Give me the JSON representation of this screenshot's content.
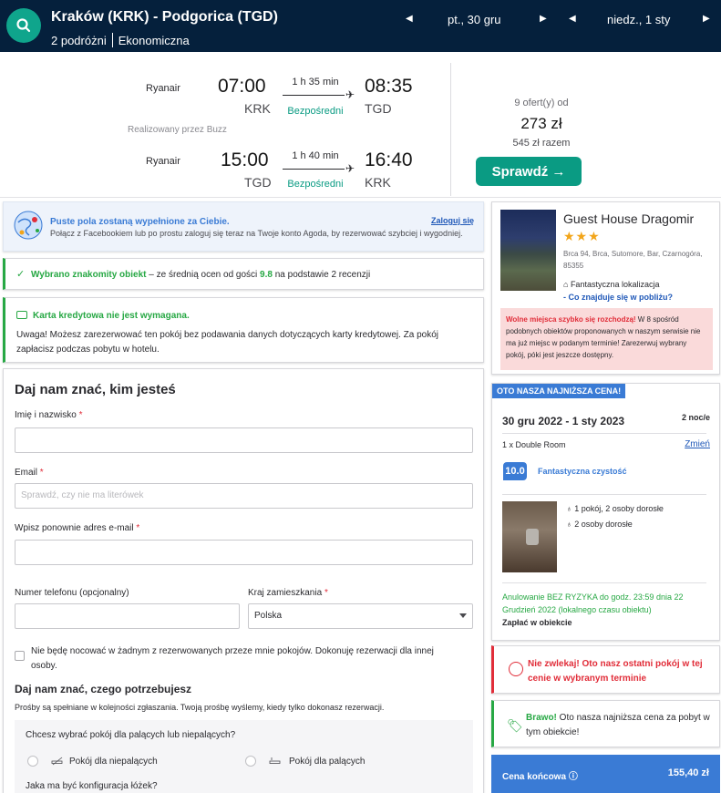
{
  "header": {
    "route": "Kraków (KRK) - Podgorica (TGD)",
    "travelers": "2 podróżni",
    "cabin": "Ekonomiczna",
    "depart_date": "pt., 30 gru",
    "return_date": "niedz., 1 sty",
    "prev_glyph": "◀",
    "next_glyph": "▶"
  },
  "flights": {
    "outbound": {
      "airline": "Ryanair",
      "dep_time": "07:00",
      "dep_airport": "KRK",
      "duration": "1 h 35 min",
      "stops": "Bezpośredni",
      "arr_time": "08:35",
      "arr_airport": "TGD"
    },
    "operated_by": "Realizowany przez Buzz",
    "return": {
      "airline": "Ryanair",
      "dep_time": "15:00",
      "dep_airport": "TGD",
      "duration": "1 h 40 min",
      "stops": "Bezpośredni",
      "arr_time": "16:40",
      "arr_airport": "KRK"
    },
    "offers": "9 ofert(y) od",
    "price": "273 zł",
    "total": "545 zł razem",
    "check_label": "Sprawdź →"
  },
  "facebook": {
    "title": "Puste pola zostaną wypełnione za Ciebie.",
    "text": "Połącz z Facebookiem lub po prostu zaloguj się teraz na Twoje konto Agoda, by rezerwować szybciej i wygodniej.",
    "login": "Zaloguj się"
  },
  "great_property": {
    "bold": "Wybrano znakomity obiekt",
    "rest_before": " – ze średnią ocen od gości ",
    "score": "9.8",
    "rest_after": " na podstawie 2 recenzji"
  },
  "card": {
    "title": "Karta kredytowa nie jest wymagana.",
    "text": "Uwaga! Możesz zarezerwować ten pokój bez podawania danych dotyczących karty kredytowej. Za pokój zapłacisz podczas pobytu w hotelu."
  },
  "form": {
    "heading": "Daj nam znać, kim jesteś",
    "name_label": "Imię i nazwisko",
    "email_label": "Email",
    "email_placeholder": "Sprawdź, czy nie ma literówek",
    "email2_label": "Wpisz ponownie adres e-mail",
    "phone_label": "Numer telefonu (opcjonalny)",
    "country_label": "Kraj zamieszkania",
    "country_value": "Polska",
    "required_mark": "*",
    "not_staying": "Nie będę nocować w żadnym z rezerwowanych przeze mnie pokojów. Dokonuję rezerwacji dla innej osoby.",
    "needs_heading": "Daj nam znać, czego potrzebujesz",
    "needs_text": "Prośby są spełniane w kolejności zgłaszania. Twoją prośbę wyślemy, kiedy tylko dokonasz rezerwacji.",
    "smoking_q": "Chcesz wybrać pokój dla palących lub niepalących?",
    "non_smoking": "Pokój dla niepalących",
    "smoking": "Pokój dla palących",
    "bed_q": "Jaka ma być konfiguracja łóżek?"
  },
  "hotel": {
    "name": "Guest House Dragomir",
    "stars": "★★★",
    "address": "Brca 94, Brca, Sutomore, Bar, Czarnogóra, 85355",
    "location": "Fantastyczna lokalizacja",
    "nearby": "- Co znajduje się w pobliżu?",
    "alert_bold": "Wolne miejsca szybko się rozchodzą!",
    "alert_text": " W 8 spośród podobnych obiektów proponowanych w naszym serwisie nie ma już miejsc w podanym terminie! Zarezerwuj wybrany pokój, póki jest jeszcze dostępny."
  },
  "price_box": {
    "badge": "OTO NASZA NAJNIŻSZA CENA!",
    "dates": "30 gru 2022 - 1 sty 2023",
    "nights": "2 noc/e",
    "room": "1 x Double Room",
    "change": "Zmień",
    "score": "10.0",
    "score_label": "Fantastyczna czystość",
    "occupancy": "1 pokój, 2 osoby dorosłe",
    "beds": "2 osoby dorosłe",
    "cancel": "Anulowanie BEZ RYZYKA do godz. 23:59 dnia 22 Grudzień 2022 (lokalnego czasu obiektu)",
    "pay": "Zapłać w obiekcie"
  },
  "last_room": "Nie zwlekaj! Oto nasz ostatni pokój w tej cenie w wybranym terminie",
  "bravo": {
    "bold": "Brawo!",
    "text": " Oto nasza najniższa cena za pobyt w tym obiekcie!"
  },
  "final": {
    "label": "Cena końcowa",
    "info_glyph": "ⓘ",
    "value": "155,40 zł"
  },
  "colors": {
    "header_bg": "#05203c",
    "accent_green": "#0a9b83",
    "agoda_blue": "#3a7bd5",
    "alert_red": "#e12d39",
    "success_green": "#27a844"
  }
}
